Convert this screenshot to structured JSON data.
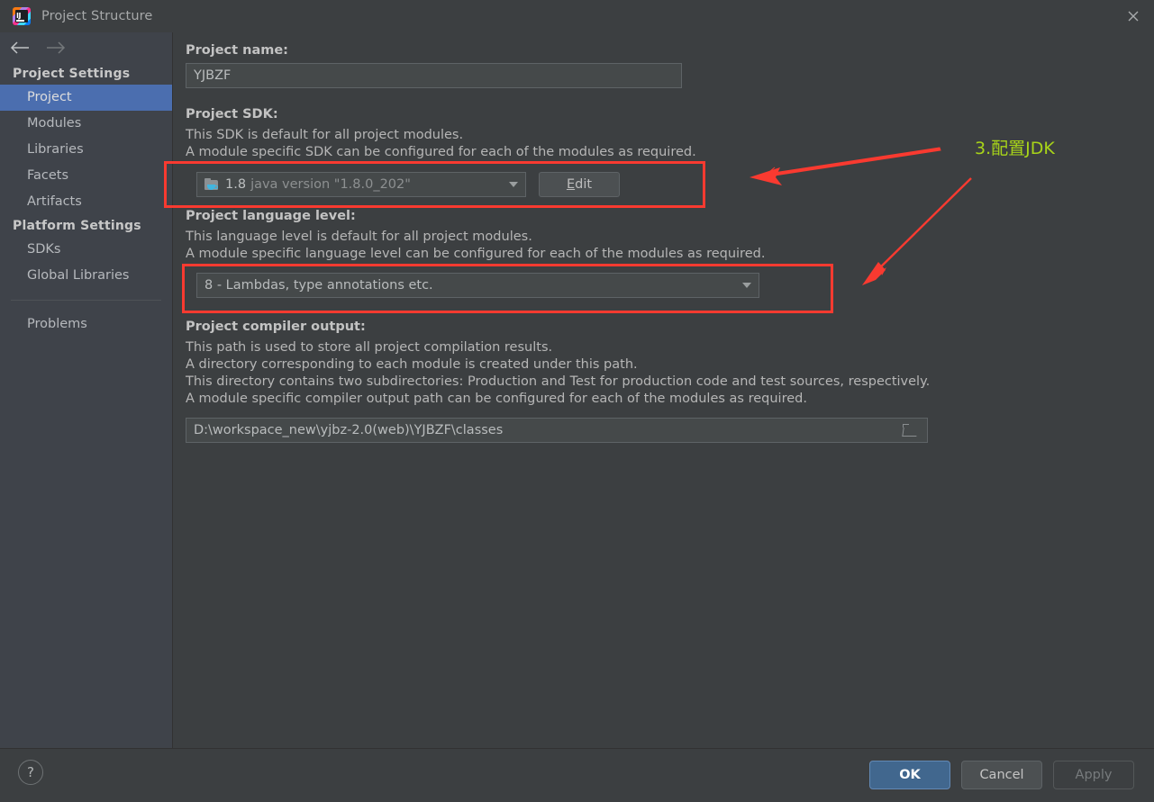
{
  "window": {
    "title": "Project Structure",
    "app_icon": "intellij-idea-icon",
    "close_icon": "close-icon"
  },
  "sidebar": {
    "back_icon": "arrow-left-icon",
    "forward_icon": "arrow-right-icon",
    "groups": [
      {
        "header": "Project Settings",
        "items": [
          {
            "label": "Project",
            "selected": true
          },
          {
            "label": "Modules",
            "selected": false
          },
          {
            "label": "Libraries",
            "selected": false
          },
          {
            "label": "Facets",
            "selected": false
          },
          {
            "label": "Artifacts",
            "selected": false
          }
        ]
      },
      {
        "header": "Platform Settings",
        "items": [
          {
            "label": "SDKs",
            "selected": false
          },
          {
            "label": "Global Libraries",
            "selected": false
          }
        ]
      }
    ],
    "problems_label": "Problems"
  },
  "main": {
    "project_name": {
      "label": "Project name:",
      "value": "YJBZF"
    },
    "project_sdk": {
      "label": "Project SDK:",
      "desc1": "This SDK is default for all project modules.",
      "desc2": "A module specific SDK can be configured for each of the modules as required.",
      "sdk_icon": "java-sdk-folder-icon",
      "sdk_version": "1.8",
      "sdk_detail": "java version \"1.8.0_202\"",
      "dropdown_icon": "chevron-down-icon",
      "edit_button": "Edit",
      "edit_button_mnemonic": "E",
      "edit_button_rest": "dit"
    },
    "language_level": {
      "label": "Project language level:",
      "desc1": "This language level is default for all project modules.",
      "desc2": "A module specific language level can be configured for each of the modules as required.",
      "value": "8 - Lambdas, type annotations etc.",
      "dropdown_icon": "chevron-down-icon"
    },
    "compiler_output": {
      "label": "Project compiler output:",
      "desc1": "This path is used to store all project compilation results.",
      "desc2": "A directory corresponding to each module is created under this path.",
      "desc3": "This directory contains two subdirectories: Production and Test for production code and test sources, respectively.",
      "desc4": "A module specific compiler output path can be configured for each of the modules as required.",
      "value": "D:\\workspace_new\\yjbz-2.0(web)\\YJBZF\\classes",
      "browse_icon": "folder-browse-icon"
    }
  },
  "annotations": {
    "label_text": "3.配置JDK",
    "label_color": "#a8d419",
    "highlight_color": "#f93a30",
    "arrow_icon": "red-arrow-icon"
  },
  "footer": {
    "help_icon": "help-question-icon",
    "help_label": "?",
    "buttons": [
      {
        "label": "OK",
        "style": "primary"
      },
      {
        "label": "Cancel",
        "style": "normal"
      },
      {
        "label": "Apply",
        "style": "disabled"
      }
    ]
  },
  "colors": {
    "background": "#3c3f41",
    "sidebar": "#3f434a",
    "selection": "#4b6eaf",
    "accent_red": "#f93a30",
    "accent_green": "#a8d419",
    "primary_button": "#41678e"
  }
}
